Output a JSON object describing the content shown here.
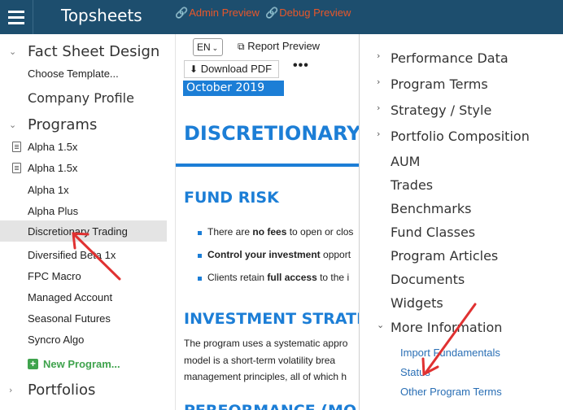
{
  "topbar": {
    "title": "Topsheets",
    "admin_preview": "Admin Preview",
    "debug_preview": "Debug Preview"
  },
  "sidebar": {
    "fact_sheet_design": "Fact Sheet Design",
    "choose_template": "Choose Template...",
    "company_profile": "Company Profile",
    "programs": "Programs",
    "program_items": [
      "Alpha 1.5x",
      "Alpha 1.5x",
      "Alpha 1x",
      "Alpha Plus",
      "Discretionary Trading",
      "Diversified Beta 1x",
      "FPC Macro",
      "Managed Account",
      "Seasonal Futures",
      "Syncro Algo"
    ],
    "new_program": "New Program...",
    "portfolios": "Portfolios"
  },
  "preview": {
    "language": "EN",
    "report_preview": "Report Preview",
    "download_pdf": "Download PDF",
    "more": "•••",
    "date": "October  2019",
    "title": "DISCRETIONARY T",
    "fund_risk": "FUND RISK",
    "bullets": [
      {
        "pre": "There are ",
        "bold": "no fees",
        "post": " to open or clos"
      },
      {
        "pre": "",
        "bold": "Control your investment",
        "post": " opport"
      },
      {
        "pre": "Clients retain ",
        "bold": "full access",
        "post": " to the i"
      }
    ],
    "investment_strategy": "INVESTMENT STRATE",
    "body_lines": [
      "The program uses a systematic appro",
      "model is a short-term volatility brea",
      "management principles, all of which h"
    ],
    "performance_partial": "PERFORMANCE (MO"
  },
  "rightpanel": {
    "items": [
      {
        "label": "Performance Data",
        "caret": "›"
      },
      {
        "label": "Program Terms",
        "caret": "›"
      },
      {
        "label": "Strategy / Style",
        "caret": "›"
      },
      {
        "label": "Portfolio Composition",
        "caret": "›"
      },
      {
        "label": "AUM",
        "caret": ""
      },
      {
        "label": "Trades",
        "caret": ""
      },
      {
        "label": "Benchmarks",
        "caret": ""
      },
      {
        "label": "Fund Classes",
        "caret": ""
      },
      {
        "label": "Program Articles",
        "caret": ""
      },
      {
        "label": "Documents",
        "caret": ""
      },
      {
        "label": "Widgets",
        "caret": ""
      },
      {
        "label": "More Information",
        "caret": "⌄"
      }
    ],
    "sub_items": [
      "Import Fundamentals",
      "Status",
      "Other Program Terms"
    ]
  },
  "colors": {
    "topbar": "#1d4e6e",
    "accent_blue": "#1c7ed6",
    "preview_link": "#e8572a",
    "arrow_red": "#e03131",
    "new_program_green": "#3fa34d"
  }
}
